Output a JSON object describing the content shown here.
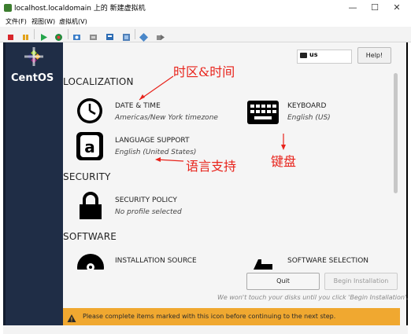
{
  "window": {
    "title": "localhost.localdomain 上的 新建虚拟机",
    "minimize_glyph": "—",
    "maximize_glyph": "☐",
    "close_glyph": "✕"
  },
  "menu": {
    "items": [
      "文件(F)",
      "视图(W)",
      "虚拟机(V)"
    ]
  },
  "toolbar": {
    "icons": [
      "stop-icon",
      "pause-icon",
      "play-icon",
      "restart-icon",
      "snapshot-icon",
      "screenshot-icon",
      "console-icon",
      "settings-icon",
      "network-icon",
      "send-keys-icon"
    ]
  },
  "installer": {
    "distro_name": "CentOS",
    "keyboard_layout": "us",
    "help_label": "Help!",
    "sections": {
      "localization": "LOCALIZATION",
      "security": "SECURITY",
      "software": "SOFTWARE"
    },
    "spokes": {
      "date_time": {
        "title": "DATE & TIME",
        "status": "Americas/New York timezone"
      },
      "keyboard": {
        "title": "KEYBOARD",
        "status": "English (US)"
      },
      "language": {
        "title": "LANGUAGE SUPPORT",
        "status": "English (United States)"
      },
      "security_policy": {
        "title": "SECURITY POLICY",
        "status": "No profile selected"
      },
      "installation_source": {
        "title": "INSTALLATION SOURCE"
      },
      "software_selection": {
        "title": "SOFTWARE SELECTION"
      }
    },
    "quit_label": "Quit",
    "begin_label": "Begin Installation",
    "hint": "We won't touch your disks until you click 'Begin Installation'.",
    "warning": "Please complete items marked with this icon before continuing to the next step."
  },
  "annotations": {
    "timezone": "时区&时间",
    "language": "语言支持",
    "keyboard": "键盘",
    "color": "#e8231b"
  }
}
